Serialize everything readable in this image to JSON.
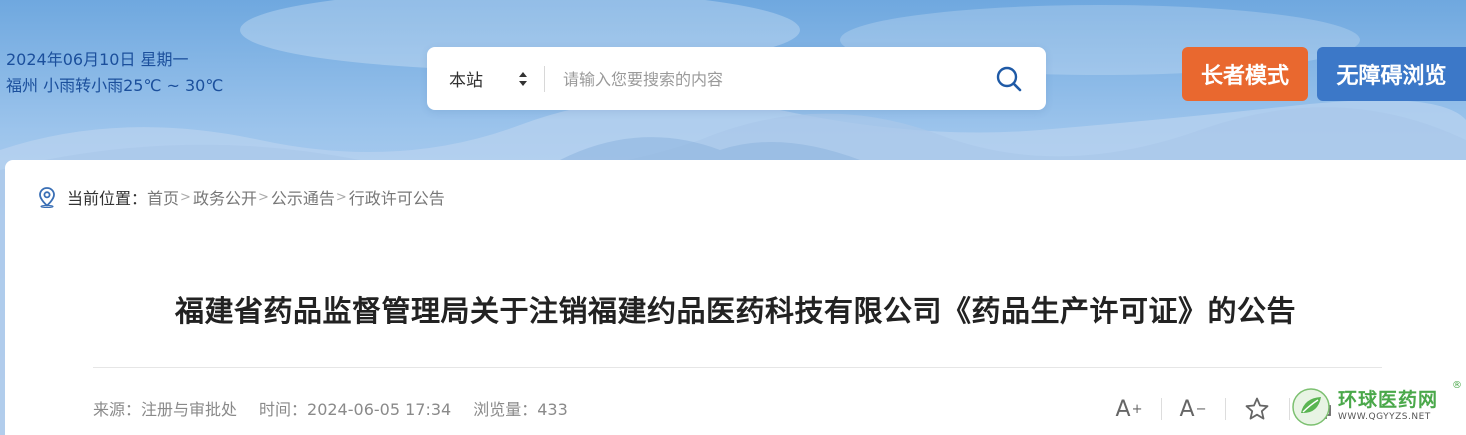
{
  "header": {
    "date": "2024年06月10日 星期一",
    "weather": "福州 小雨转小雨25℃ ~ 30℃"
  },
  "search": {
    "scope": "本站",
    "placeholder": "请输入您要搜索的内容"
  },
  "buttons": {
    "elder_mode": "长者模式",
    "accessibility": "无障碍浏览"
  },
  "breadcrumb": {
    "lead": "当前位置：",
    "items": [
      "首页",
      "政务公开",
      "公示通告",
      "行政许可公告"
    ],
    "separator": ">"
  },
  "article": {
    "title": "福建省药品监督管理局关于注销福建约品医药科技有限公司《药品生产许可证》的公告",
    "source": "来源：注册与审批处",
    "time": "时间：2024-06-05 17:34",
    "views": "浏览量：433"
  },
  "tools": {
    "font_increase": "A",
    "font_increase_mark": "+",
    "font_decrease": "A",
    "font_decrease_mark": "−"
  },
  "watermark": {
    "name": "环球医药网",
    "url": "WWW.QGYYZS.NET",
    "reg": "®"
  },
  "colors": {
    "elder_button": "#e9682f",
    "accessibility_button": "#3c78c8",
    "date_text": "#1b4f9c"
  }
}
